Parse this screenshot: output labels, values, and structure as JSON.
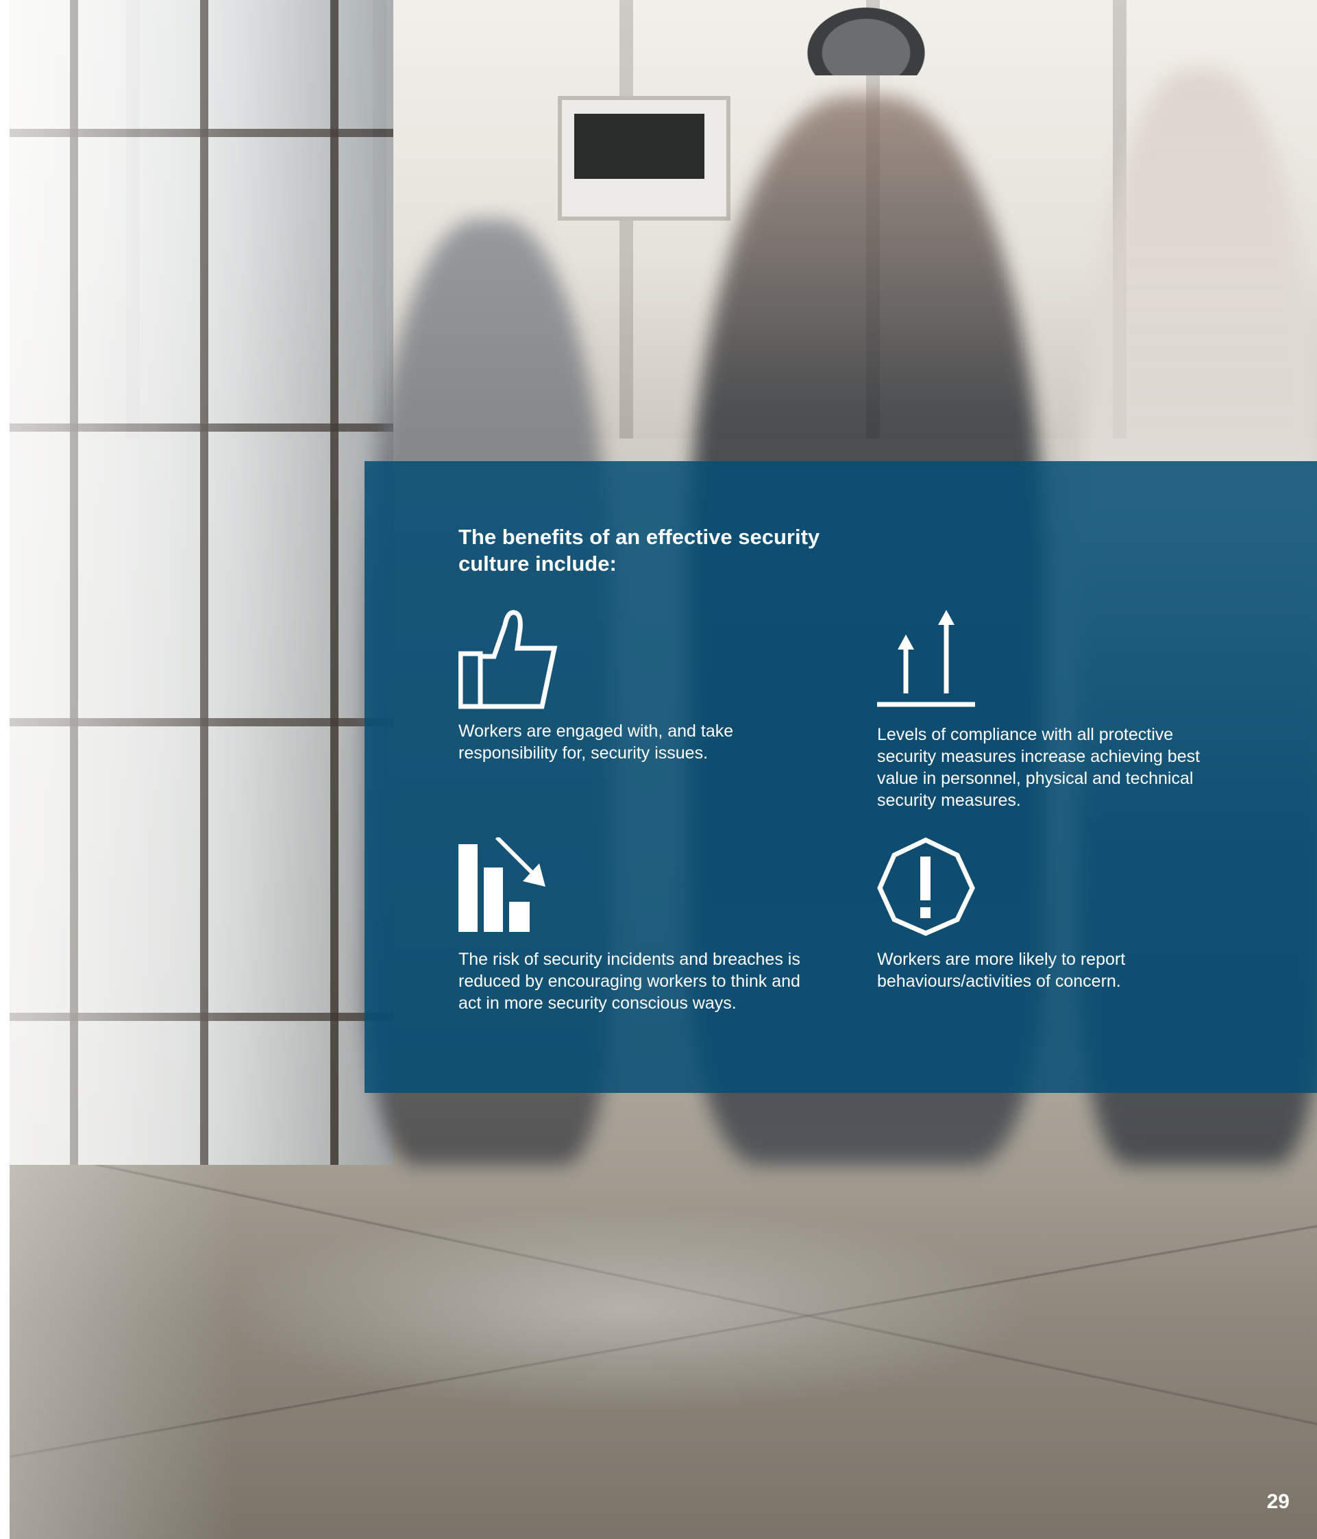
{
  "panel": {
    "title": "The benefits of an effective security culture include:",
    "benefits": [
      {
        "icon": "thumbs-up-icon",
        "text": "Workers are engaged with, and take responsibility for, security issues."
      },
      {
        "icon": "rising-arrows-icon",
        "text": "Levels of compliance with all protective security measures increase achieving best value in personnel, physical and technical security measures."
      },
      {
        "icon": "declining-bar-chart-icon",
        "text": "The risk of security incidents and breaches is reduced by encouraging workers to think and act in more security conscious ways."
      },
      {
        "icon": "exclamation-heptagon-icon",
        "text": "Workers are more likely to report behaviours/activities of concern."
      }
    ]
  },
  "page_number": "29",
  "colors": {
    "panel": "#064e76",
    "text": "#ffffff"
  }
}
